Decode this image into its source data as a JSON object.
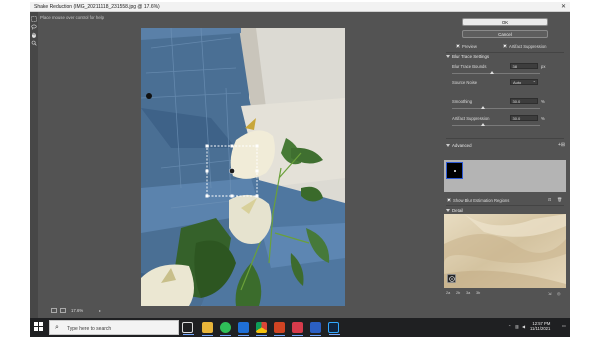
{
  "window": {
    "title": "Shake Reduction (IMG_20211118_231558.jpg @ 17.6%)",
    "close_glyph": "✕"
  },
  "hint": "Place mouse over control for help",
  "canvas": {
    "zoom": "17.6%",
    "zoom_arrow": "▸"
  },
  "panel": {
    "ok_label": "OK",
    "cancel_label": "Cancel",
    "preview_label": "Preview",
    "artifact_suppression_toggle_label": "Artifact Suppression",
    "blur_trace_settings_header": "Blur Trace Settings",
    "blur_trace_bounds": {
      "label": "Blur Trace Bounds",
      "value": "38",
      "unit": "px",
      "level": 0.45
    },
    "source_noise": {
      "label": "Source Noise",
      "value": "Auto"
    },
    "smoothing": {
      "label": "Smoothing",
      "value": "30.0",
      "unit": "%",
      "level": 0.35
    },
    "artifact_suppression": {
      "label": "Artifact Suppression",
      "value": "30.0",
      "unit": "%",
      "level": 0.35
    },
    "advanced_header": "Advanced",
    "show_regions_label": "Show Blur Estimation Regions",
    "detail_header": "Detail",
    "detail_footer": [
      "2a",
      "2b",
      "3a",
      "3b"
    ]
  },
  "taskbar": {
    "search_placeholder": "Type here to search",
    "time": "12:57 PM",
    "date": "11/11/2021",
    "apps": [
      "task-view",
      "file-explorer",
      "whatsapp",
      "mail",
      "chrome",
      "powerpoint",
      "word-red",
      "word",
      "photoshop"
    ]
  },
  "colors": {
    "dialog_bg": "#535353",
    "button_ok": "#e9e9e9",
    "selection_blue": "#2c59d6",
    "taskbar_bg": "#1f2022"
  }
}
